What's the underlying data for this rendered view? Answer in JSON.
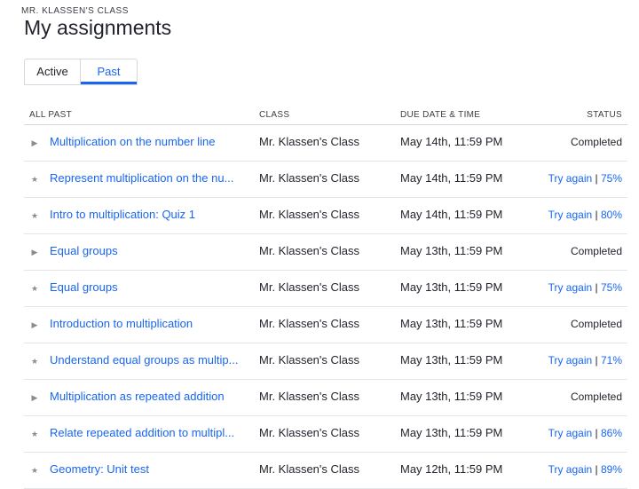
{
  "header": {
    "class_label": "MR. KLASSEN'S CLASS",
    "title": "My assignments"
  },
  "tabs": [
    {
      "label": "Active",
      "selected": false
    },
    {
      "label": "Past",
      "selected": true
    }
  ],
  "table": {
    "columns": {
      "name": "ALL PAST",
      "class": "CLASS",
      "due": "DUE DATE & TIME",
      "status": "STATUS"
    },
    "rows": [
      {
        "icon": "play-triangle-icon",
        "name": "Multiplication on the number line",
        "class": "Mr. Klassen's Class",
        "due": "May 14th, 11:59 PM",
        "status": "Completed",
        "action": "",
        "sep": "",
        "score": ""
      },
      {
        "icon": "star-icon",
        "name": "Represent multiplication on the nu...",
        "class": "Mr. Klassen's Class",
        "due": "May 14th, 11:59 PM",
        "status": "",
        "action": "Try again",
        "sep": " | ",
        "score": "75%"
      },
      {
        "icon": "star-icon",
        "name": "Intro to multiplication: Quiz 1",
        "class": "Mr. Klassen's Class",
        "due": "May 14th, 11:59 PM",
        "status": "",
        "action": "Try again",
        "sep": " | ",
        "score": "80%"
      },
      {
        "icon": "play-triangle-icon",
        "name": "Equal groups",
        "class": "Mr. Klassen's Class",
        "due": "May 13th, 11:59 PM",
        "status": "Completed",
        "action": "",
        "sep": "",
        "score": ""
      },
      {
        "icon": "star-icon",
        "name": "Equal groups",
        "class": "Mr. Klassen's Class",
        "due": "May 13th, 11:59 PM",
        "status": "",
        "action": "Try again",
        "sep": " | ",
        "score": "75%"
      },
      {
        "icon": "play-triangle-icon",
        "name": "Introduction to multiplication",
        "class": "Mr. Klassen's Class",
        "due": "May 13th, 11:59 PM",
        "status": "Completed",
        "action": "",
        "sep": "",
        "score": ""
      },
      {
        "icon": "star-icon",
        "name": "Understand equal groups as multip...",
        "class": "Mr. Klassen's Class",
        "due": "May 13th, 11:59 PM",
        "status": "",
        "action": "Try again",
        "sep": " | ",
        "score": "71%"
      },
      {
        "icon": "play-triangle-icon",
        "name": "Multiplication as repeated addition",
        "class": "Mr. Klassen's Class",
        "due": "May 13th, 11:59 PM",
        "status": "Completed",
        "action": "",
        "sep": "",
        "score": ""
      },
      {
        "icon": "star-icon",
        "name": "Relate repeated addition to multipl...",
        "class": "Mr. Klassen's Class",
        "due": "May 13th, 11:59 PM",
        "status": "",
        "action": "Try again",
        "sep": " | ",
        "score": "86%"
      },
      {
        "icon": "star-icon",
        "name": "Geometry: Unit test",
        "class": "Mr. Klassen's Class",
        "due": "May 12th, 11:59 PM",
        "status": "",
        "action": "Try again",
        "sep": " | ",
        "score": "89%"
      }
    ]
  },
  "colors": {
    "accent": "#1865f2",
    "text": "#21242c",
    "border": "#d6d8da",
    "icon": "#8a8c91"
  }
}
